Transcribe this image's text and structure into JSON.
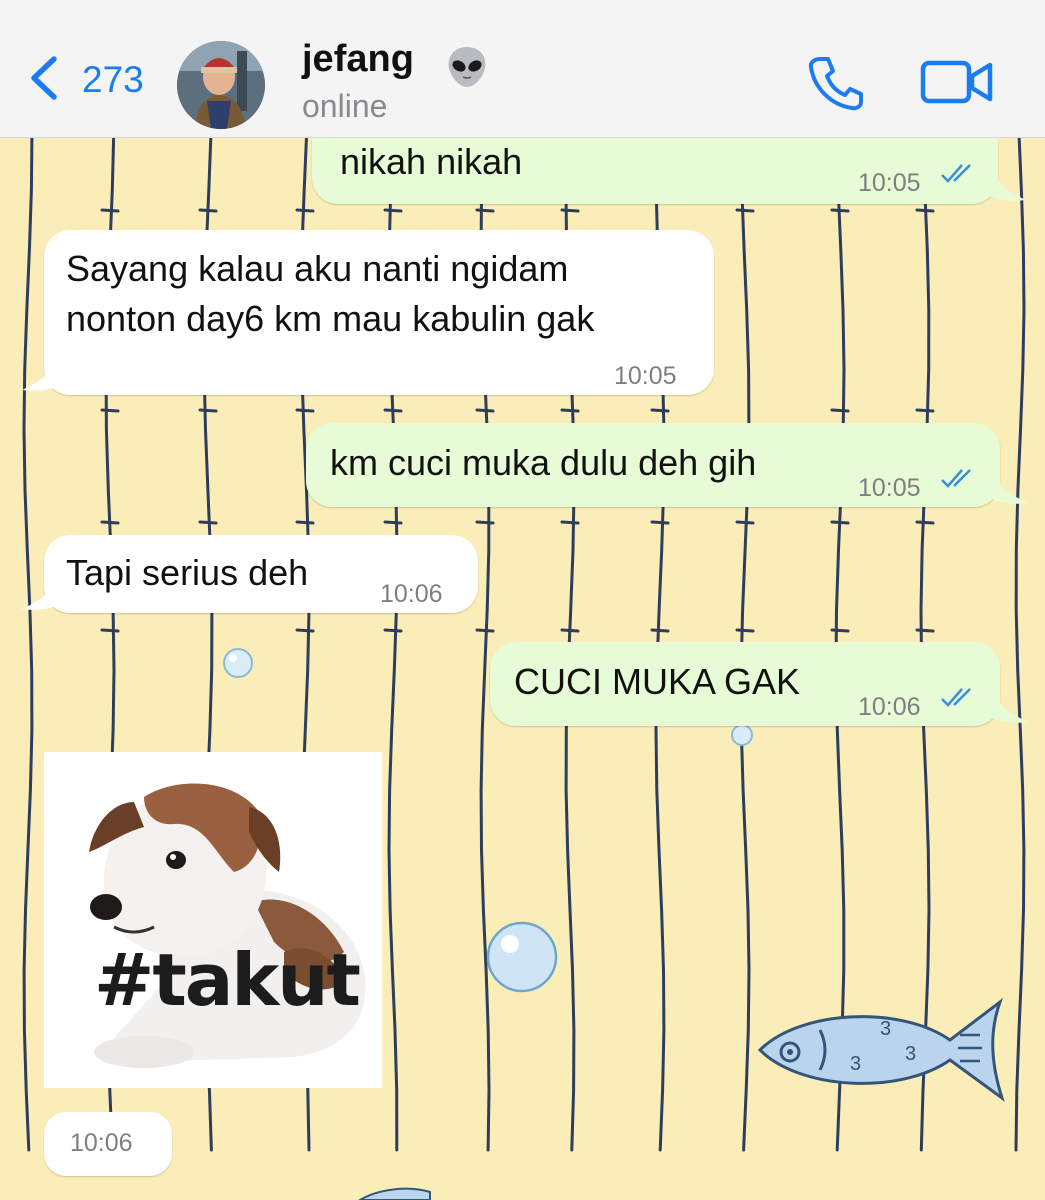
{
  "header": {
    "back_count": "273",
    "contact_name": "jefang",
    "status": "online",
    "accent_color": "#1a7cf0",
    "icons": [
      "chevron-left-icon",
      "alien-emoji-icon",
      "phone-icon",
      "video-camera-icon"
    ]
  },
  "messages": [
    {
      "direction": "out",
      "text": "nikah nikah",
      "time": "10:05",
      "status": "read"
    },
    {
      "direction": "in",
      "text": "Sayang kalau aku nanti ngidam\nnonton day6 km mau kabulin gak",
      "time": "10:05"
    },
    {
      "direction": "out",
      "text": "km cuci muka dulu deh gih",
      "time": "10:05",
      "status": "read"
    },
    {
      "direction": "in",
      "text": "Tapi serius deh",
      "time": "10:06"
    },
    {
      "direction": "out",
      "text": "CUCI MUKA GAK",
      "time": "10:06",
      "status": "read"
    },
    {
      "direction": "in",
      "type": "sticker",
      "sticker_text": "#takut",
      "time": "10:06"
    }
  ],
  "colors": {
    "wallpaper": "#fbedb7",
    "stripe": "#2e3d5c",
    "outgoing_bubble": "#e7fbd7",
    "incoming_bubble": "#ffffff",
    "read_ticks": "#3a8fd6"
  }
}
